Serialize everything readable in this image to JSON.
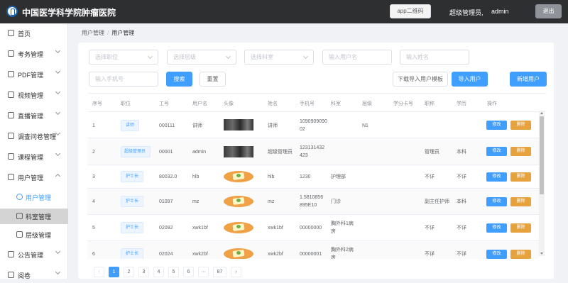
{
  "header": {
    "app_title": "中国医学科学院肿瘤医院",
    "qr_button": "app二维码",
    "role": "超级管理员,",
    "username": "admin",
    "logout": "退出"
  },
  "sidebar": {
    "items": [
      {
        "label": "首页"
      },
      {
        "label": "考务管理"
      },
      {
        "label": "PDF管理"
      },
      {
        "label": "视频管理"
      },
      {
        "label": "直播管理"
      },
      {
        "label": "调查问卷管理"
      },
      {
        "label": "课程管理"
      },
      {
        "label": "用户管理"
      },
      {
        "label": "用户管理"
      },
      {
        "label": "科室管理"
      },
      {
        "label": "层级管理"
      },
      {
        "label": "公告管理"
      },
      {
        "label": "阅卷"
      }
    ]
  },
  "breadcrumb": {
    "root": "用户管理",
    "sep": "/",
    "current": "用户管理"
  },
  "filters": {
    "position_placeholder": "选择职位",
    "level_placeholder": "选择层级",
    "dept_placeholder": "选择科室",
    "username_placeholder": "输入用户名",
    "name_placeholder": "输入姓名",
    "phone_placeholder": "输入手机号",
    "search": "搜索",
    "reset": "重置",
    "download_template": "下载导入用户模板",
    "import_users": "导入用户",
    "add_user": "新增用户"
  },
  "table": {
    "headers": [
      "序号",
      "职位",
      "工号",
      "用户名",
      "头像",
      "姓名",
      "手机号",
      "科室",
      "层级",
      "学分卡号",
      "职称",
      "学历",
      "操作"
    ],
    "edit_label": "修改",
    "delete_label": "删除",
    "rows": [
      {
        "no": "1",
        "position": "讲师",
        "empno": "000111",
        "username": "讲师",
        "avatar": "dark",
        "name": "讲师",
        "phone": "1090909090\n02",
        "dept": "",
        "level": "N1",
        "card": "",
        "title": "",
        "edu": ""
      },
      {
        "no": "2",
        "position": "超级管理员",
        "empno": "00001",
        "username": "admin",
        "avatar": "dark",
        "name": "超级管理员",
        "phone": "123131432\n423",
        "dept": "",
        "level": "",
        "card": "",
        "title": "管理员",
        "edu": "本科"
      },
      {
        "no": "3",
        "position": "护士长",
        "empno": "80032.0",
        "username": "hlb",
        "avatar": "pie",
        "name": "hlb",
        "phone": "1230",
        "dept": "护理部",
        "level": "",
        "card": "",
        "title": "不详",
        "edu": "不详"
      },
      {
        "no": "4",
        "position": "护士长",
        "empno": "01097",
        "username": "mz",
        "avatar": "pie",
        "name": "mz",
        "phone": "1.5810856\n895E10",
        "dept": "门诊",
        "level": "",
        "card": "",
        "title": "副主任护师",
        "edu": "本科"
      },
      {
        "no": "5",
        "position": "护士长",
        "empno": "02092",
        "username": "xwk1bf",
        "avatar": "pie",
        "name": "xwk1bf",
        "phone": "00000000",
        "dept": "胸外科1病\n房",
        "level": "",
        "card": "",
        "title": "不详",
        "edu": "不详"
      },
      {
        "no": "6",
        "position": "护士长",
        "empno": "02024",
        "username": "xwk2bf",
        "avatar": "pie",
        "name": "xwk2bf",
        "phone": "00000001",
        "dept": "胸外科2病\n房",
        "level": "",
        "card": "",
        "title": "不详",
        "edu": "不详"
      }
    ]
  },
  "pagination": {
    "prev": "‹",
    "pages": [
      "1",
      "2",
      "3",
      "4",
      "5",
      "6",
      "···",
      "87"
    ],
    "current": "1",
    "next": "›"
  }
}
